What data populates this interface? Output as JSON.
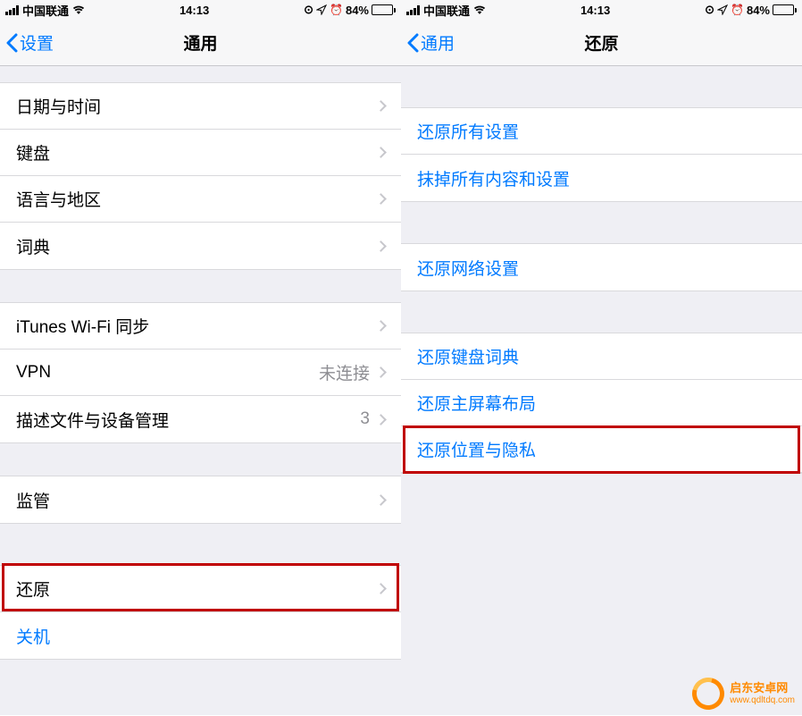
{
  "status": {
    "carrier": "中国联通",
    "time": "14:13",
    "battery_pct": "84%"
  },
  "left": {
    "back_label": "设置",
    "title": "通用",
    "group1": [
      {
        "label": "日期与时间"
      },
      {
        "label": "键盘"
      },
      {
        "label": "语言与地区"
      },
      {
        "label": "词典"
      }
    ],
    "group2": [
      {
        "label": "iTunes Wi-Fi 同步",
        "detail": ""
      },
      {
        "label": "VPN",
        "detail": "未连接"
      },
      {
        "label": "描述文件与设备管理",
        "detail": "3"
      }
    ],
    "group3": [
      {
        "label": "监管"
      }
    ],
    "group4": [
      {
        "label": "还原"
      },
      {
        "label": "关机"
      }
    ]
  },
  "right": {
    "back_label": "通用",
    "title": "还原",
    "group1": [
      {
        "label": "还原所有设置"
      },
      {
        "label": "抹掉所有内容和设置"
      }
    ],
    "group2": [
      {
        "label": "还原网络设置"
      }
    ],
    "group3": [
      {
        "label": "还原键盘词典"
      },
      {
        "label": "还原主屏幕布局"
      },
      {
        "label": "还原位置与隐私"
      }
    ]
  },
  "watermark": {
    "title": "启东安卓网",
    "url": "www.qdltdq.com"
  },
  "colors": {
    "link": "#007aff",
    "bg": "#efeff4",
    "cell_border": "#d9d9dc",
    "highlight": "#c00000",
    "accent_orange": "#ff8a00"
  }
}
